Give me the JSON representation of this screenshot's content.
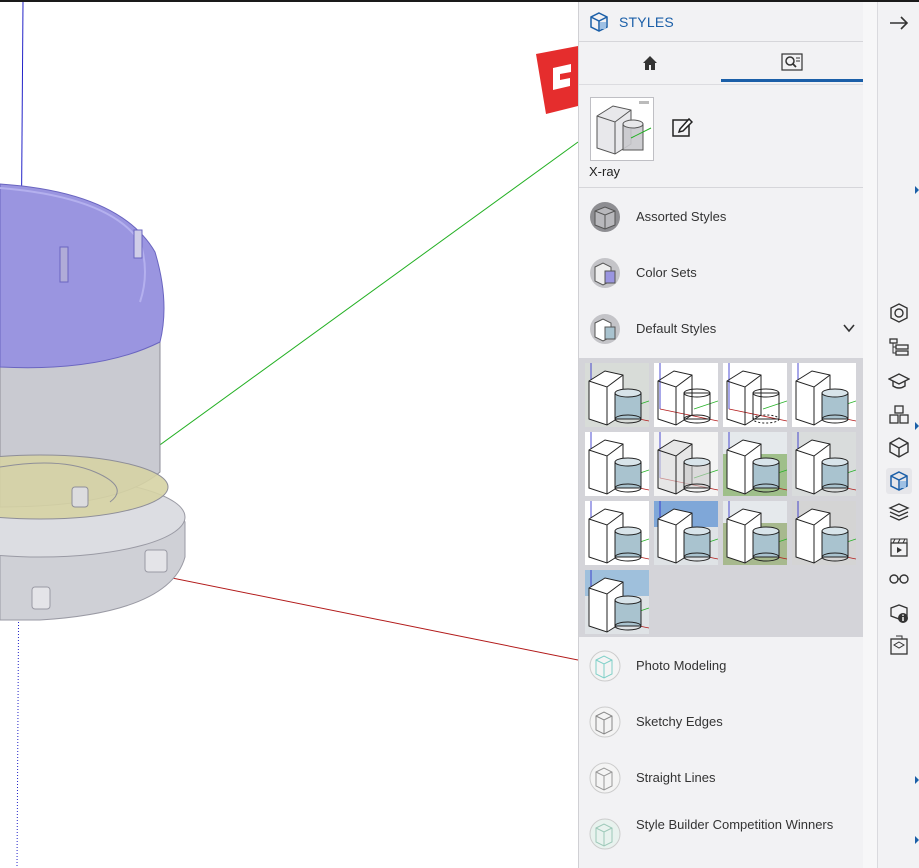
{
  "panel": {
    "title": "STYLES",
    "title_icon": "styles-cube-icon",
    "tabs": [
      {
        "name": "home",
        "icon": "home-icon",
        "active": false
      },
      {
        "name": "search-styles",
        "icon": "search-image-icon",
        "active": true
      }
    ],
    "current_style": {
      "name": "X-ray",
      "edit_icon": "edit-icon"
    },
    "collections": [
      {
        "label": "Assorted Styles",
        "icon": "assorted-styles-icon"
      },
      {
        "label": "Color Sets",
        "icon": "color-sets-icon"
      },
      {
        "label": "Default Styles",
        "icon": "default-styles-icon",
        "expanded": true
      },
      {
        "label": "Photo Modeling",
        "icon": "photo-modeling-icon"
      },
      {
        "label": "Sketchy Edges",
        "icon": "sketchy-edges-icon"
      },
      {
        "label": "Straight Lines",
        "icon": "straight-lines-icon"
      },
      {
        "label": "Style Builder Competition Winners",
        "icon": "style-builder-icon"
      }
    ],
    "default_styles_thumbnails": [
      {
        "bg": "#d8dcd8",
        "face": "#ffffff",
        "cyl": "#a9c3cf",
        "variant": "solid-tint"
      },
      {
        "bg": "#ffffff",
        "face": "#ffffff",
        "cyl": "#ffffff",
        "variant": "wire"
      },
      {
        "bg": "#ffffff",
        "face": "#ffffff",
        "cyl": "#ffffff",
        "variant": "hidden"
      },
      {
        "bg": "#ffffff",
        "face": "#ffffff",
        "cyl": "#a9c3cf",
        "variant": "solid"
      },
      {
        "bg": "#ffffff",
        "face": "#ffffff",
        "cyl": "#a9c3cf",
        "variant": "solid"
      },
      {
        "bg": "#f4f4f4",
        "face": "#dcdcdc",
        "cyl": "#c8c8c8",
        "variant": "xray"
      },
      {
        "bg": "#9fbf8a",
        "face": "#ffffff",
        "cyl": "#a9c3cf",
        "variant": "green"
      },
      {
        "bg": "#d9dcdc",
        "face": "#ffffff",
        "cyl": "#a9c3cf",
        "variant": "solid-tint"
      },
      {
        "bg": "#ffffff",
        "face": "#ffffff",
        "cyl": "#a9c3cf",
        "variant": "solid"
      },
      {
        "bg": "#7fa7d8",
        "face": "#ffffff",
        "cyl": "#a9c3cf",
        "variant": "sky"
      },
      {
        "bg": "#a7b98e",
        "face": "#ffffff",
        "cyl": "#a9c3cf",
        "variant": "green"
      },
      {
        "bg": "#d4d4d4",
        "face": "#ffffff",
        "cyl": "#a9c3cf",
        "variant": "solid-tint"
      },
      {
        "bg": "#9fc0dc",
        "face": "#ffffff",
        "cyl": "#a9c3cf",
        "variant": "sky"
      }
    ]
  },
  "rail": {
    "collapse_icon": "arrow-right-icon",
    "items": [
      {
        "icon": "entity-info-icon",
        "active": false
      },
      {
        "icon": "outliner-icon",
        "active": false
      },
      {
        "icon": "instructor-icon",
        "active": false
      },
      {
        "icon": "components-icon",
        "active": false
      },
      {
        "icon": "materials-icon",
        "active": false
      },
      {
        "icon": "styles-icon",
        "active": true
      },
      {
        "icon": "tags-icon",
        "active": false
      },
      {
        "icon": "scenes-icon",
        "active": false
      },
      {
        "icon": "display-icon",
        "active": false
      },
      {
        "icon": "model-info-icon",
        "active": false
      },
      {
        "icon": "extension-warehouse-icon",
        "active": false
      }
    ]
  },
  "colors": {
    "accent": "#1b5fa8",
    "x_axis": "#b21a1a",
    "y_axis": "#23b023",
    "z_axis": "#2323c8",
    "model_top": "#9a95e0",
    "model_body": "#c9cad1",
    "model_ring": "#d6d3a4",
    "logo_red": "#e52d2d"
  }
}
